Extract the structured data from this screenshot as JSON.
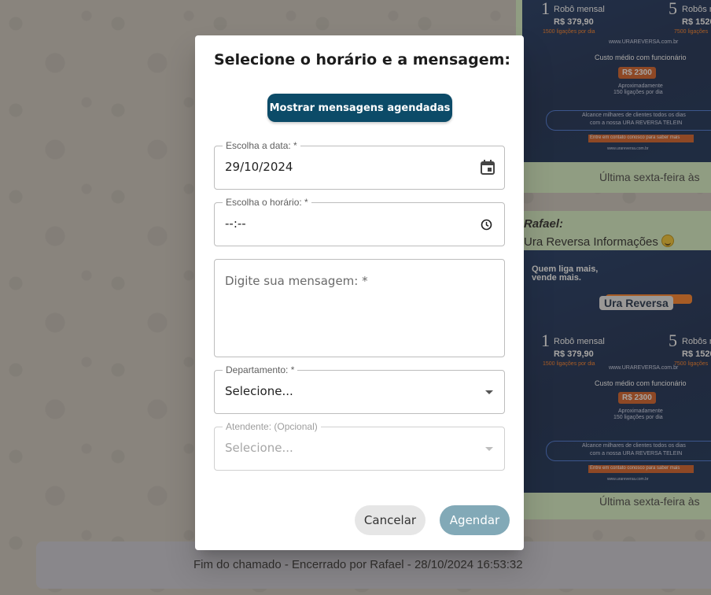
{
  "background": {
    "promo_top": {
      "plan1_number": "1",
      "plan1_label": "Robô mensal",
      "plan1_price": "R$ 379,90",
      "plan1_calls": "1500 ligações por dia",
      "plan2_number": "5",
      "plan2_label": "Robôs m",
      "plan2_price": "R$ 1520",
      "plan2_calls": "7500 ligações",
      "site": "www.URAREVERSA.com.br",
      "cost_label": "Custo médio com funcionário",
      "cost_value": "R$ 2300",
      "cost_note_1": "Aproximadamente",
      "cost_note_2": "150 ligações por dia",
      "reach_line_1": "Alcance milhares de clientes todos os dias",
      "reach_line_2": "com a nossa URA REVERSA TELEIN",
      "contact": "Entre em contato conosco para saber mais",
      "footer": "www.urareversa.com.br"
    },
    "caption_top": "Última sexta-feira às",
    "sender": "Rafael:",
    "sender_message": "Ura Reversa Informações",
    "promo_bottom": {
      "headline_1": "Quem liga mais,",
      "headline_2": "vende mais.",
      "brand": "Ura Reversa",
      "plan1_number": "1",
      "plan1_label": "Robô mensal",
      "plan1_price": "R$ 379,90",
      "plan1_calls": "1500 ligações por dia",
      "plan2_number": "5",
      "plan2_label": "Robôs m",
      "plan2_price": "R$ 1520",
      "plan2_calls": "7500 ligações",
      "site": "www.URAREVERSA.com.br",
      "cost_label": "Custo médio com funcionário",
      "cost_value": "R$ 2300",
      "cost_note_1": "Aproximadamente",
      "cost_note_2": "150 ligações por dia",
      "reach_line_1": "Alcance milhares de clientes todos os dias",
      "reach_line_2": "com a nossa URA REVERSA TELEIN",
      "contact": "Entre em contato conosco para saber mais",
      "footer": "www.urareversa.com.br"
    },
    "caption_bottom": "Última sexta-feira às",
    "end_of_ticket": "Fim do chamado - Encerrado por Rafael - 28/10/2024 16:53:32"
  },
  "dialog": {
    "title": "Selecione o horário e a mensagem:",
    "show_scheduled_button": "Mostrar mensagens agendadas",
    "date_field": {
      "label": "Escolha a data: *",
      "value": "29/10/2024",
      "icon": "calendar-icon"
    },
    "time_field": {
      "label": "Escolha o horário: *",
      "value": "--:--",
      "icon": "clock-icon"
    },
    "message_field": {
      "placeholder": "Digite sua mensagem: *",
      "value": ""
    },
    "department_field": {
      "label": "Departamento: *",
      "value": "Selecione..."
    },
    "attendant_field": {
      "label": "Atendente: (Opcional)",
      "value": "Selecione...",
      "disabled": true
    },
    "cancel_button": "Cancelar",
    "submit_button": "Agendar"
  },
  "colors": {
    "primary": "#0c4b68",
    "submit_disabled": "#82a9b7",
    "cancel_bg": "#e6e6e6",
    "chat_bubble": "#d5f0c4",
    "promo_bg": "#0d2a5a",
    "promo_accent": "#d2561a"
  }
}
